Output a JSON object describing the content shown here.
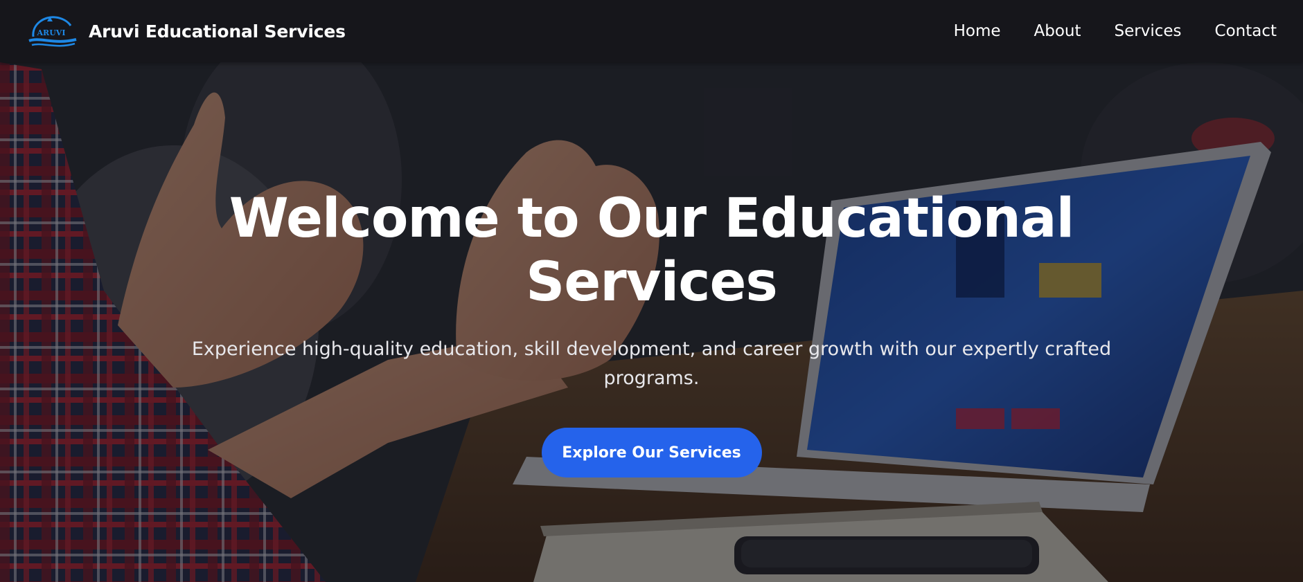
{
  "brand": {
    "logo_text": "ARUVI",
    "name": "Aruvi Educational Services"
  },
  "nav": {
    "items": [
      {
        "label": "Home"
      },
      {
        "label": "About"
      },
      {
        "label": "Services"
      },
      {
        "label": "Contact"
      }
    ]
  },
  "hero": {
    "title": "Welcome to Our Educational Services",
    "subtitle": "Experience high-quality education, skill development, and career growth with our expertly crafted programs.",
    "cta_label": "Explore Our Services"
  },
  "colors": {
    "navbar_bg": "#16161b",
    "accent": "#2563eb",
    "logo_blue": "#1e88e5"
  }
}
